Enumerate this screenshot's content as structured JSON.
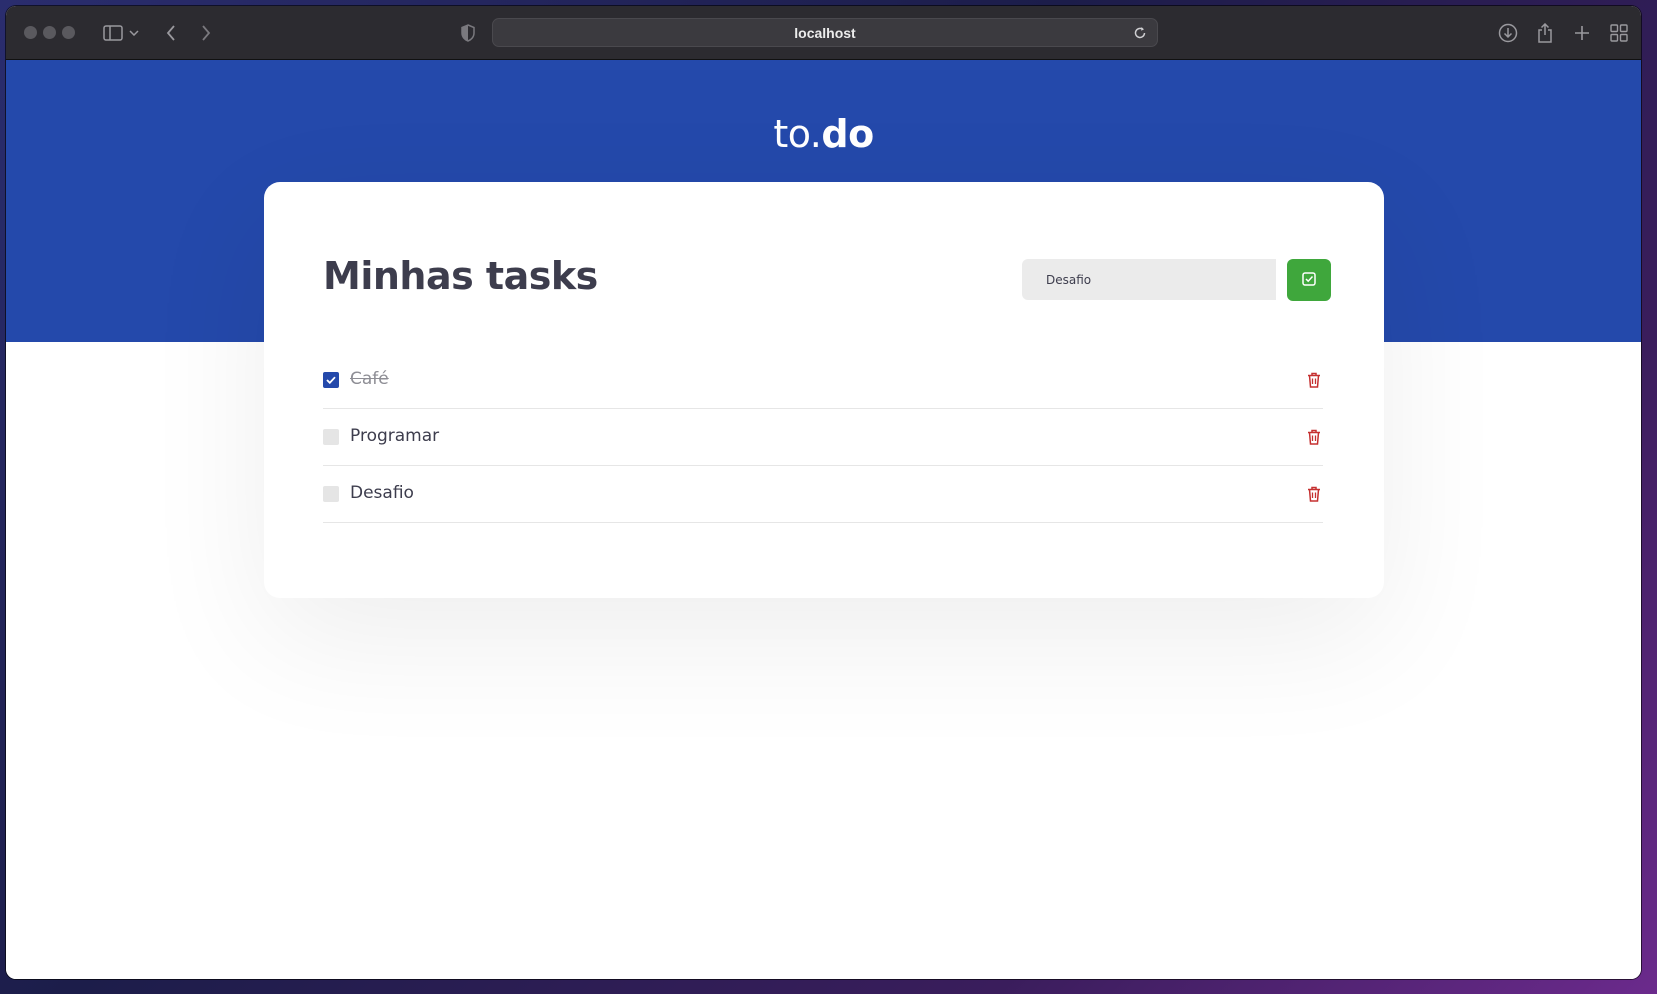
{
  "browser": {
    "url": "localhost",
    "icons": [
      "sidebar-icon",
      "chevron-down-icon",
      "back-icon",
      "forward-icon",
      "shield-icon",
      "reload-icon",
      "download-icon",
      "share-icon",
      "new-tab-icon",
      "tab-overview-icon"
    ]
  },
  "app": {
    "logo_prefix": "to.",
    "logo_suffix": "do",
    "title": "Minhas tasks",
    "input_value": "Desafio",
    "colors": {
      "brand": "#2449ab",
      "add": "#3fa73c",
      "delete": "#c53030"
    }
  },
  "tasks": [
    {
      "label": "Café",
      "done": true
    },
    {
      "label": "Programar",
      "done": false
    },
    {
      "label": "Desafio",
      "done": false
    }
  ]
}
